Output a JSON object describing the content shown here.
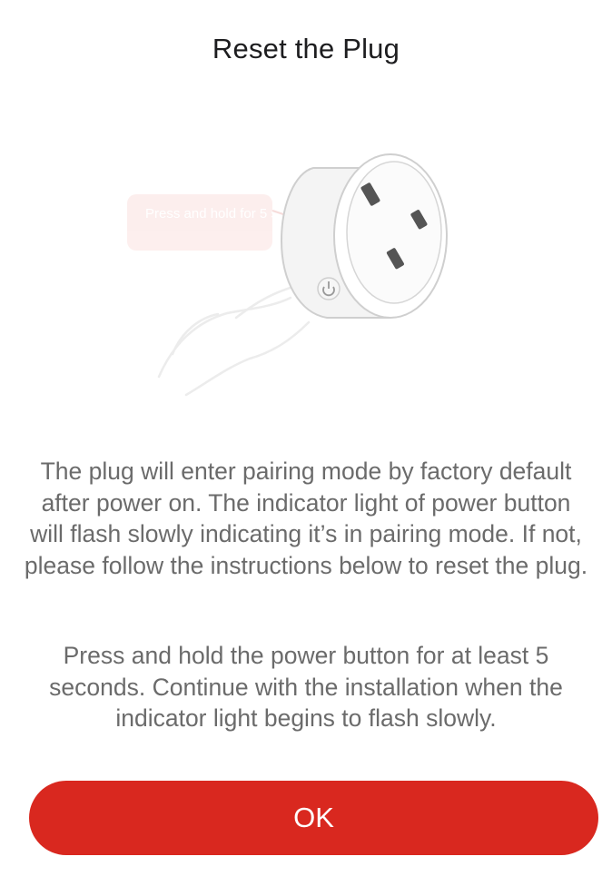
{
  "header": {
    "title": "Reset the Plug"
  },
  "illustration": {
    "callout_text": "Press and hold for 5 secs",
    "icons": [
      "smart-plug-icon",
      "hand-icon",
      "power-icon"
    ]
  },
  "content": {
    "paragraph_1": "The plug will enter pairing mode by factory default after power on. The indicator light of power button will flash slowly indicating it’s in pairing mode. If not, please follow the instructions below to reset the plug.",
    "paragraph_2": "Press and hold the power button for at least 5 seconds. Continue with the installation when the indicator light begins to flash slowly."
  },
  "actions": {
    "ok_label": "OK"
  },
  "colors": {
    "accent": "#d9281f",
    "title": "#1d1d1f",
    "body_text": "#6b6b6b",
    "background": "#ffffff"
  }
}
